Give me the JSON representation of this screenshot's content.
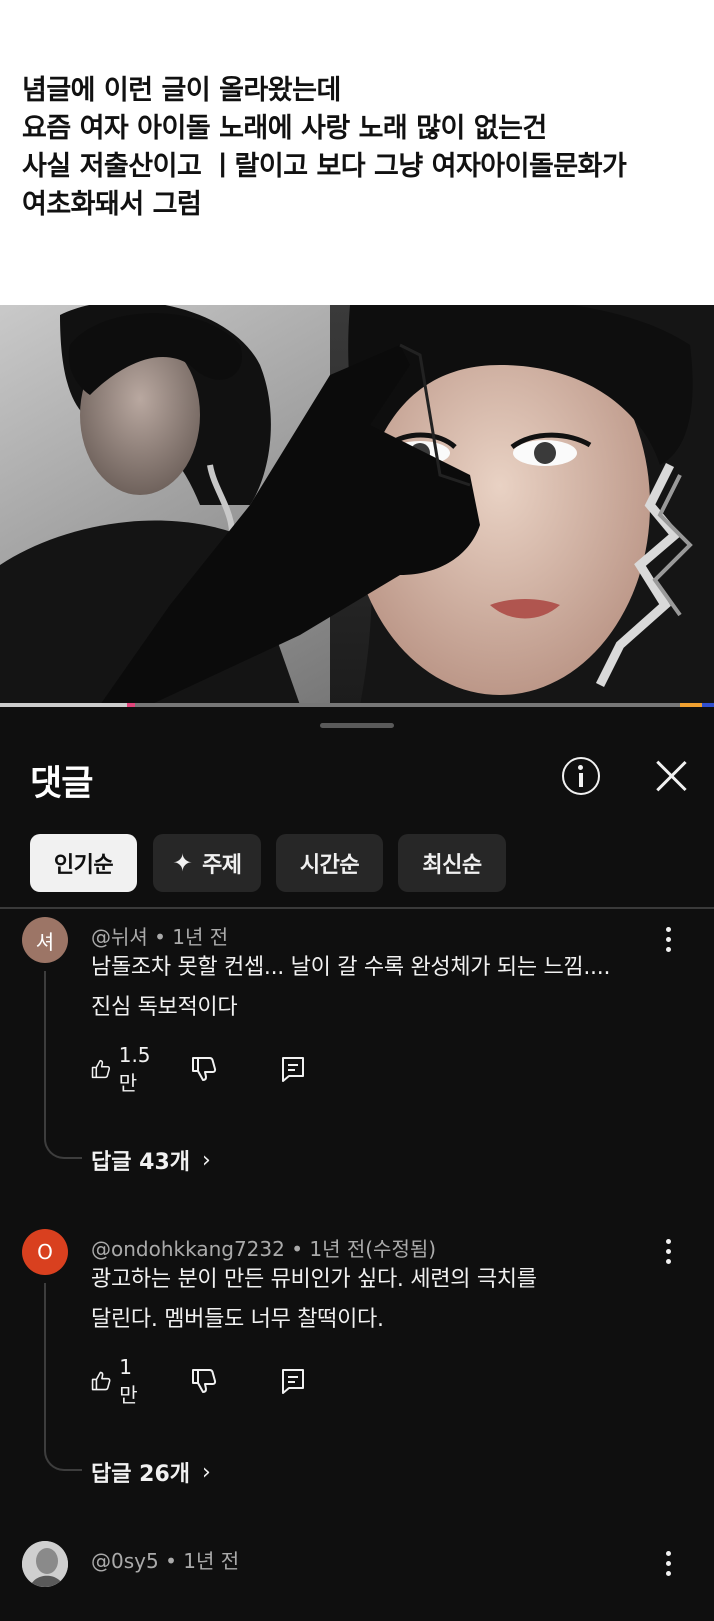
{
  "caption": {
    "lines": [
      "념글에 이런 글이 올라왔는데",
      "요즘 여자 아이돌 노래에 사랑 노래 많이 없는건",
      "사실 저출산이고 ㅣ랄이고 보다 그냥 여자아이돌문화가",
      "여초화돼서 그럼"
    ]
  },
  "video": {
    "progress_fraction": 0.18,
    "colors": {
      "played": "#cccccc",
      "marker_pink": "#e0457b",
      "marker_orange": "#f0a030",
      "marker_blue": "#3050d0"
    }
  },
  "sheet": {
    "title": "댓글",
    "info_icon": "info-circle-icon",
    "close_icon": "close-icon",
    "chips": [
      {
        "label": "인기순",
        "active": true
      },
      {
        "label": "주제",
        "icon": "sparkle-icon",
        "glyph": "✦",
        "active": false
      },
      {
        "label": "시간순",
        "active": false
      },
      {
        "label": "최신순",
        "active": false
      }
    ]
  },
  "comments": [
    {
      "avatar_text": "셔",
      "avatar_color": "#9c7566",
      "author": "@뉘셔",
      "time": "1년 전",
      "meta": "@뉘셔 • 1년 전",
      "lines": [
        "남돌조차 못할 컨셉... 날이 갈 수록 완성체가 되는 느낌....",
        "진심 독보적이다"
      ],
      "likes": "1.5만",
      "replies": "답글 43개"
    },
    {
      "avatar_text": "O",
      "avatar_color": "#d9401f",
      "author": "@ondohkkang7232",
      "time": "1년 전(수정됨)",
      "meta": "@ondohkkang7232 • 1년 전(수정됨)",
      "lines": [
        "광고하는 분이 만든 뮤비인가 싶다. 세련의 극치를",
        "달린다. 멤버들도 너무 찰떡이다."
      ],
      "likes": "1만",
      "replies": "답글 26개"
    },
    {
      "avatar_text": "",
      "avatar_color": "#bdbdbd",
      "author": "@0sy5",
      "time": "1년 전",
      "meta": "@0sy5 • 1년 전"
    }
  ]
}
